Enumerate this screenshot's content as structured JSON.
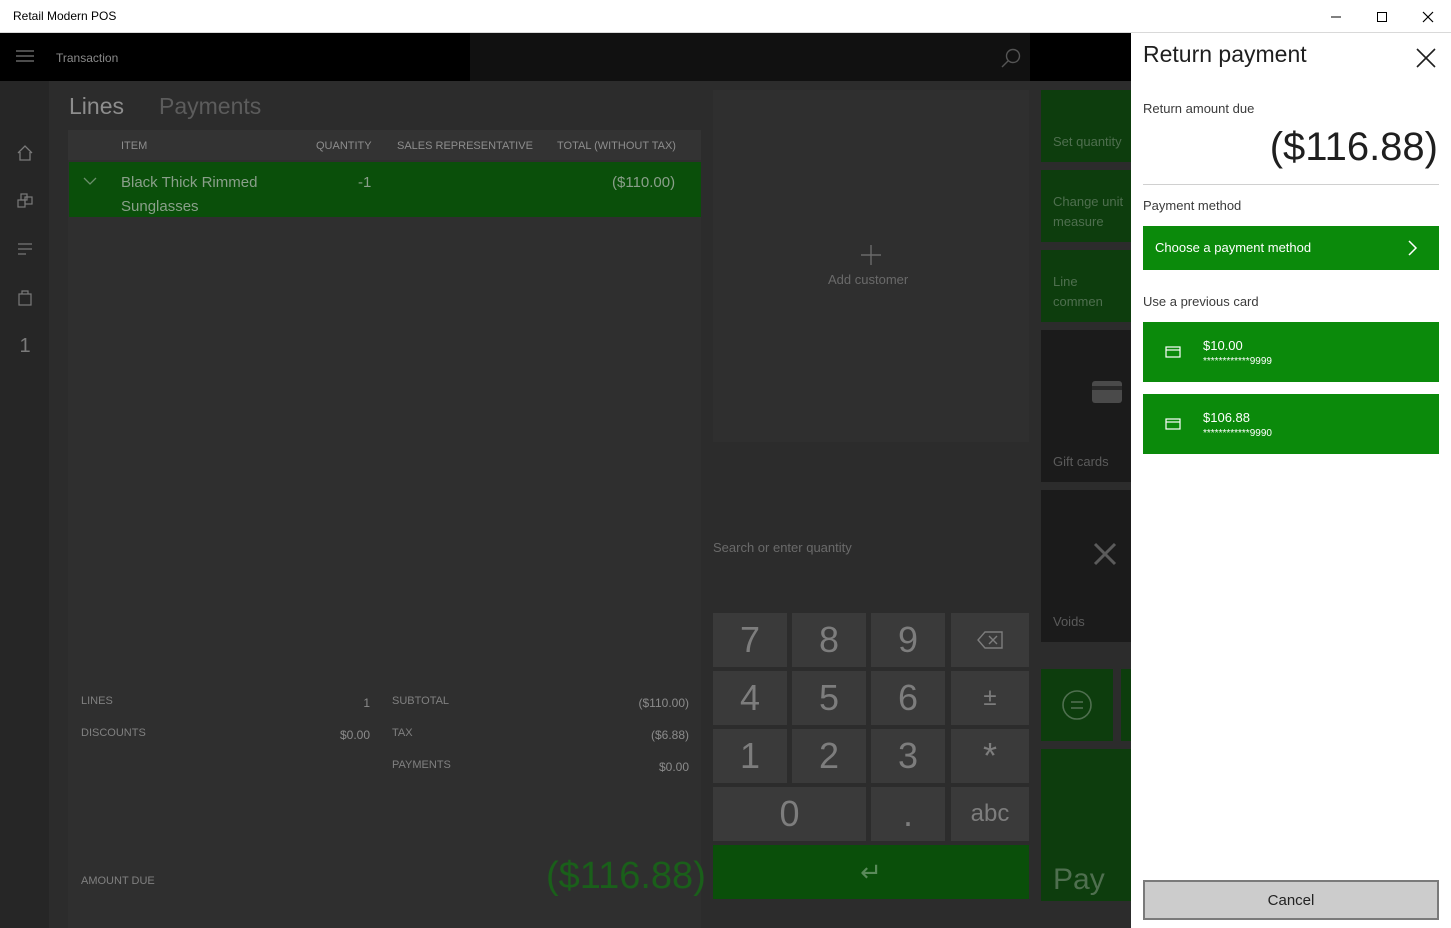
{
  "window": {
    "title": "Retail Modern POS",
    "min_icon": "minimize-icon",
    "max_icon": "maximize-icon",
    "close_icon": "close-icon"
  },
  "app": {
    "breadcrumb": "Transaction",
    "tabs": [
      "Lines",
      "Payments"
    ],
    "grid_headers": {
      "item": "ITEM",
      "quantity": "QUANTITY",
      "sales_rep": "SALES REPRESENTATIVE",
      "total": "TOTAL (WITHOUT TAX)"
    },
    "line": {
      "item_line1": "Black Thick Rimmed",
      "item_line2": "Sunglasses",
      "quantity": "-1",
      "total": "($110.00)"
    },
    "totals": {
      "lines_label": "LINES",
      "lines_value": "1",
      "discounts_label": "DISCOUNTS",
      "discounts_value": "$0.00",
      "subtotal_label": "SUBTOTAL",
      "subtotal_value": "($110.00)",
      "tax_label": "TAX",
      "tax_value": "($6.88)",
      "payments_label": "PAYMENTS",
      "payments_value": "$0.00",
      "amount_due_label": "AMOUNT DUE",
      "amount_due_value": "($116.88)"
    },
    "add_customer": "Add customer",
    "search_placeholder": "Search or enter quantity",
    "keypad": {
      "k7": "7",
      "k8": "8",
      "k9": "9",
      "k4": "4",
      "k5": "5",
      "k6": "6",
      "k1": "1",
      "k2": "2",
      "k3": "3",
      "k0": "0",
      "kdot": ".",
      "kplusminus": "±",
      "kstar": "*",
      "kabc": "abc",
      "enter": "↵"
    },
    "tiles": {
      "set_quantity": "Set quantity",
      "change_unit_1": "Change unit",
      "change_unit_2": "measure",
      "line_comment": "Line commen",
      "gift_cards": "Gift cards",
      "voids": "Voids",
      "pay": "Pay"
    },
    "nav_count": "1"
  },
  "pane": {
    "title": "Return payment",
    "return_label": "Return amount due",
    "return_amount": "($116.88)",
    "payment_method_label": "Payment method",
    "choose_button": "Choose a payment method",
    "previous_card_label": "Use a previous card",
    "cards": [
      {
        "amount": "$10.00",
        "number": "************9999"
      },
      {
        "amount": "$106.88",
        "number": "************9990"
      }
    ],
    "cancel": "Cancel"
  },
  "colors": {
    "accent_green": "#0b8a0b",
    "overlay_bg": "#2c2c2c",
    "pane_bg": "#ffffff"
  }
}
